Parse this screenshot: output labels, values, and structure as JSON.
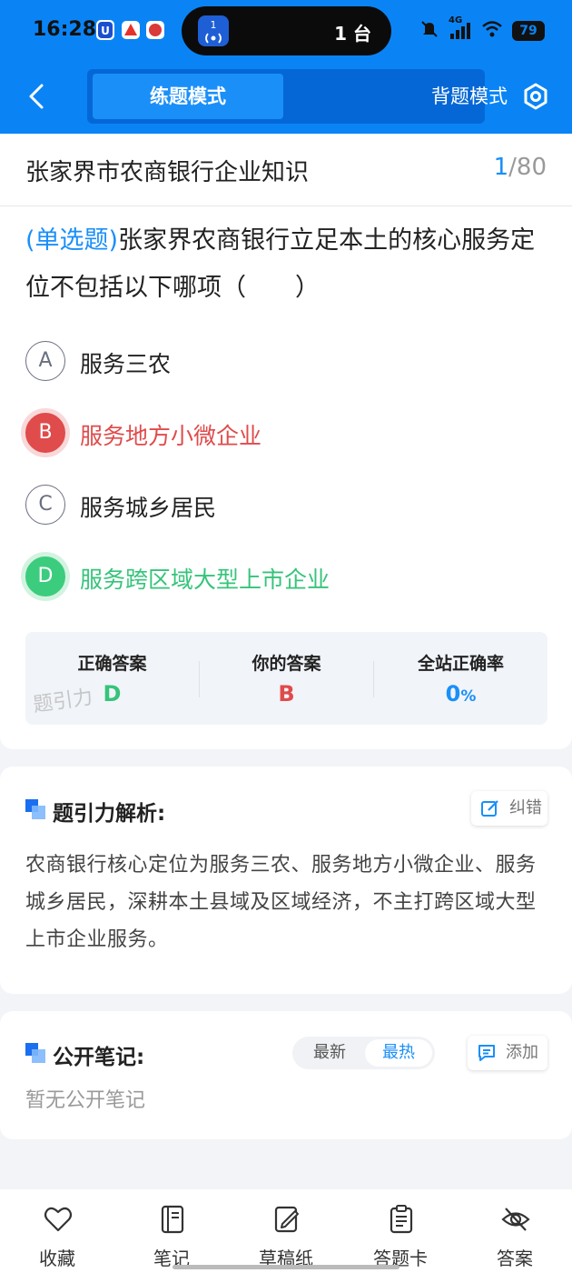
{
  "status_bar": {
    "time": "16:28",
    "island_badge": "1",
    "island_text": "1 台",
    "network": "4G",
    "battery": "79"
  },
  "header": {
    "tabs": [
      {
        "label": "练题模式",
        "active": true
      },
      {
        "label": "背题模式",
        "active": false
      }
    ]
  },
  "quiz": {
    "title": "张家界市农商银行企业知识",
    "current": "1",
    "total": "/80",
    "question_type": "(单选题)",
    "question_text": "张家界农商银行立足本土的核心服务定位不包括以下哪项（　　）",
    "options": [
      {
        "letter": "A",
        "text": "服务三农",
        "state": "normal"
      },
      {
        "letter": "B",
        "text": "服务地方小微企业",
        "state": "wrong"
      },
      {
        "letter": "C",
        "text": "服务城乡居民",
        "state": "normal"
      },
      {
        "letter": "D",
        "text": "服务跨区域大型上市企业",
        "state": "correct"
      }
    ],
    "summary": {
      "correct_label": "正确答案",
      "correct_value": "D",
      "yours_label": "你的答案",
      "yours_value": "B",
      "rate_label": "全站正确率",
      "rate_value": "0",
      "rate_unit": "%",
      "watermark": "题引力"
    }
  },
  "analysis": {
    "title": "题引力解析:",
    "report_button": "纠错",
    "text": "农商银行核心定位为服务三农、服务地方小微企业、服务城乡居民，深耕本土县域及区域经济，不主打跨区域大型上市企业服务。"
  },
  "notes": {
    "title": "公开笔记:",
    "sort_latest": "最新",
    "sort_hot": "最热",
    "add_button": "添加",
    "empty_text": "暂无公开笔记"
  },
  "bottom_nav": [
    {
      "label": "收藏",
      "icon": "heart-icon"
    },
    {
      "label": "笔记",
      "icon": "notebook-icon"
    },
    {
      "label": "草稿纸",
      "icon": "draft-icon"
    },
    {
      "label": "答题卡",
      "icon": "clipboard-icon"
    },
    {
      "label": "答案",
      "icon": "eye-off-icon"
    }
  ],
  "colors": {
    "brand_blue": "#0a84f5",
    "wrong_red": "#e04b4b",
    "correct_green": "#3ccc7e"
  }
}
